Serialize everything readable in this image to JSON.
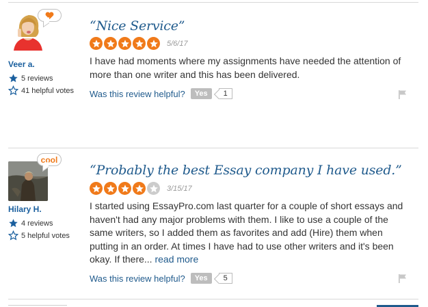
{
  "reviews": [
    {
      "badge": "heart",
      "author": "Veer a.",
      "reviews_count": "5 reviews",
      "helpful_votes": "41 helpful votes",
      "title": "“Nice Service”",
      "rating": 5,
      "date": "5/6/17",
      "body": "I have had moments where my assignments have needed the attention of more than one writer and this has been delivered.",
      "read_more": "",
      "helpful_question": "Was this review helpful?",
      "yes_label": "Yes",
      "yes_count": "1"
    },
    {
      "badge": "cool",
      "author": "Hilary H.",
      "reviews_count": "4 reviews",
      "helpful_votes": "5 helpful votes",
      "title": "“Probably the best Essay company I have used.”",
      "rating": 4,
      "date": "3/15/17",
      "body": "I started using EssayPro.com last quarter for a couple of short essays and haven't had any major problems with them. I like to use a couple of the same writers, so I added them as favorites and add (Hire) them when putting in an order. At times I have had to use other writers and it's been okay. If there...",
      "read_more": "read more",
      "helpful_question": "Was this review helpful?",
      "yes_label": "Yes",
      "yes_count": "5"
    }
  ],
  "colors": {
    "star_filled": "#f07a1a",
    "star_empty": "#cccccc",
    "link": "#1f5a8c",
    "author": "#1a5f9e"
  }
}
